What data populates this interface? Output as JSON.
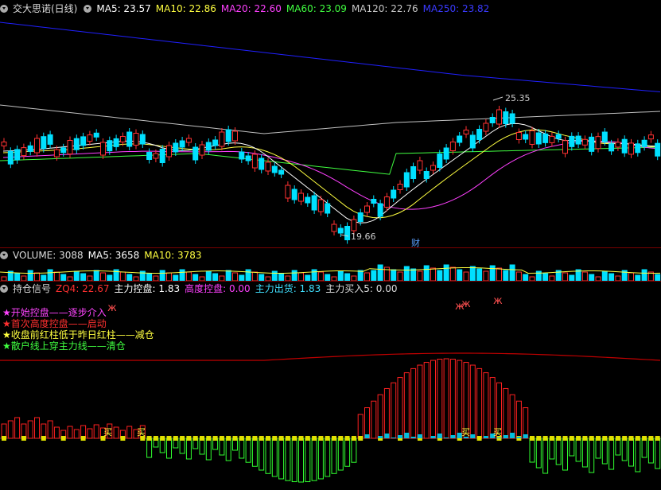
{
  "main_header": {
    "title": "交大思诺(日线)",
    "ma5": "MA5: 23.57",
    "ma10": "MA10: 22.86",
    "ma20": "MA20: 22.60",
    "ma60": "MA60: 23.09",
    "ma120": "MA120: 22.76",
    "ma250": "MA250: 23.82"
  },
  "main_chart": {
    "high_label": "25.35",
    "low_label": "19.66",
    "event_marker": "财"
  },
  "volume_header": {
    "title": "VOLUME: 3088",
    "ma5": "MA5: 3658",
    "ma10": "MA10: 3783"
  },
  "signal_header": {
    "title": "持仓信号",
    "zq4": "ZQ4: 22.67",
    "zlkp": "主力控盘: 1.83",
    "gdkp": "高度控盘: 0.00",
    "zlch": "主力出货: 1.83",
    "zlmr": "主力买入5: 0.00"
  },
  "legend": [
    {
      "text": "★开始控盘——逐步介入",
      "color": "#ff44ff"
    },
    {
      "text": "★首次高度控盘——启动",
      "color": "#ff3030"
    },
    {
      "text": "★收盘前红柱低于昨日红柱——减仓",
      "color": "#ffff40"
    },
    {
      "text": "★散户线上穿主力线——清仓",
      "color": "#40ff40"
    }
  ],
  "buy_labels": [
    "买",
    "买",
    "买",
    "买"
  ],
  "colors": {
    "up": "#ff3232",
    "down": "#00e0ff",
    "ma5": "#ffffff",
    "ma10": "#ffff40",
    "ma20": "#ff40ff",
    "ma60": "#40ff40",
    "ma120": "#c0c0c0",
    "ma250": "#2020ff"
  }
}
